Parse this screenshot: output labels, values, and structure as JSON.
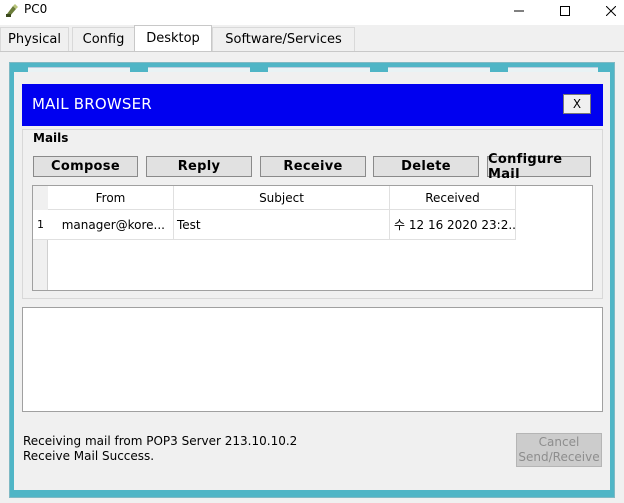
{
  "window": {
    "title": "PC0",
    "controls": {
      "minimize": "–",
      "maximize": "☐",
      "close": "✕"
    }
  },
  "tabs": [
    {
      "label": "Physical"
    },
    {
      "label": "Config"
    },
    {
      "label": "Desktop",
      "active": true
    },
    {
      "label": "Software/Services"
    }
  ],
  "mail_browser": {
    "title": "MAIL BROWSER",
    "close_label": "X",
    "group_label": "Mails",
    "buttons": {
      "compose": "Compose",
      "reply": "Reply",
      "receive": "Receive",
      "delete": "Delete",
      "configure": "Configure Mail"
    },
    "table": {
      "columns": {
        "from": "From",
        "subject": "Subject",
        "received": "Received"
      },
      "rows": [
        {
          "num": "1",
          "from": "manager@kore...",
          "subject": "Test",
          "received": "수 12 16 2020 23:2..."
        }
      ]
    },
    "status_lines": [
      "Receiving mail from POP3 Server 213.10.10.2",
      "Receive Mail Success."
    ],
    "cancel_button": {
      "line1": "Cancel",
      "line2": "Send/Receive"
    }
  },
  "colors": {
    "frame": "#4fb5c6",
    "header": "#0000f0"
  }
}
